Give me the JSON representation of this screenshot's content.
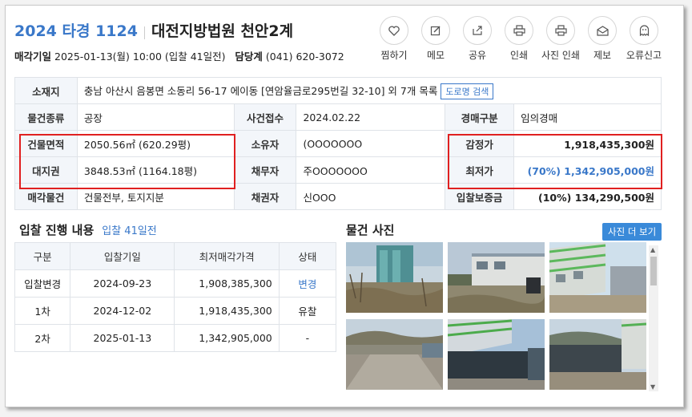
{
  "header": {
    "case_no": "2024 타경 1124",
    "court": "대전지방법원 천안2계",
    "sale_date_label": "매각기일",
    "sale_date": "2025-01-13(월) 10:00 (입찰 41일전)",
    "contact_label": "담당계",
    "contact": "(041) 620-3072"
  },
  "actions": [
    {
      "label": "찜하기",
      "icon": "heart-icon"
    },
    {
      "label": "메모",
      "icon": "edit-icon"
    },
    {
      "label": "공유",
      "icon": "share-icon"
    },
    {
      "label": "인쇄",
      "icon": "print-icon"
    },
    {
      "label": "사진 인쇄",
      "icon": "print-photo-icon"
    },
    {
      "label": "제보",
      "icon": "mail-icon"
    },
    {
      "label": "오류신고",
      "icon": "ghost-icon"
    }
  ],
  "info": {
    "location_label": "소재지",
    "location": "충남 아산시 음봉면 소동리 56-17 에이동 [연암율금로295번길 32-10] 외 7개 목록",
    "road_btn": "도로명 검색",
    "type_label": "물건종류",
    "type": "공장",
    "filed_label": "사건접수",
    "filed": "2024.02.22",
    "auction_type_label": "경매구분",
    "auction_type": "임의경매",
    "building_area_label": "건물면적",
    "building_area": "2050.56㎡ (620.29평)",
    "owner_label": "소유자",
    "owner": "(OOOOOOO",
    "appraisal_label": "감정가",
    "appraisal": "1,918,435,300원",
    "land_label": "대지권",
    "land": "3848.53㎡ (1164.18평)",
    "debtor_label": "채무자",
    "debtor": "주OOOOOOO",
    "min_price_label": "최저가",
    "min_price": "(70%) 1,342,905,000원",
    "sale_item_label": "매각물건",
    "sale_item": "건물전부, 토지지분",
    "creditor_label": "채권자",
    "creditor": "신OOO",
    "deposit_label": "입찰보증금",
    "deposit": "(10%) 134,290,500원"
  },
  "bid_section": {
    "title": "입찰 진행 내용",
    "days_left": "입찰 41일전",
    "columns": [
      "구분",
      "입찰기일",
      "최저매각가격",
      "상태"
    ],
    "rows": [
      [
        "입찰변경",
        "2024-09-23",
        "1,908,385,300",
        "변경"
      ],
      [
        "1차",
        "2024-12-02",
        "1,918,435,300",
        "유찰"
      ],
      [
        "2차",
        "2025-01-13",
        "1,342,905,000",
        "-"
      ]
    ]
  },
  "photo_section": {
    "title": "물건 사진",
    "more_btn": "사진 더 보기"
  },
  "colors": {
    "accent": "#3a78c9",
    "highlight": "#e02020"
  }
}
